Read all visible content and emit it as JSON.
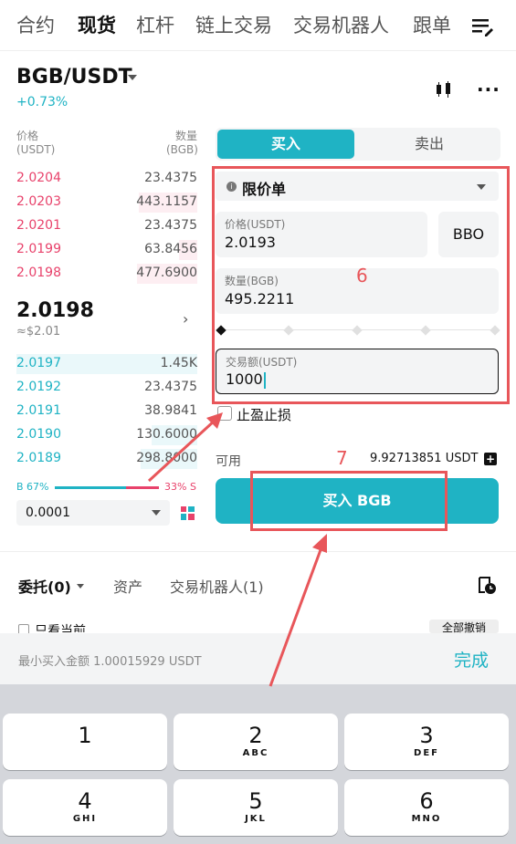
{
  "nav": {
    "tabs": [
      "合约",
      "现货",
      "杠杆",
      "链上交易",
      "交易机器人",
      "跟单"
    ],
    "active": "现货"
  },
  "pair": {
    "symbol": "BGB/USDT",
    "change": "+0.73%"
  },
  "orderbook": {
    "price_header_1": "价格",
    "price_header_2": "(USDT)",
    "qty_header_1": "数量",
    "qty_header_2": "(BGB)",
    "asks": [
      {
        "price": "2.0204",
        "qty": "23.4375"
      },
      {
        "price": "2.0203",
        "qty": "443.1157"
      },
      {
        "price": "2.0201",
        "qty": "23.4375"
      },
      {
        "price": "2.0199",
        "qty": "63.8456"
      },
      {
        "price": "2.0198",
        "qty": "477.6900"
      }
    ],
    "last_price": "2.0198",
    "last_usd": "≈$2.01",
    "bids": [
      {
        "price": "2.0197",
        "qty": "1.45K"
      },
      {
        "price": "2.0192",
        "qty": "23.4375"
      },
      {
        "price": "2.0191",
        "qty": "38.9841"
      },
      {
        "price": "2.0190",
        "qty": "130.6000"
      },
      {
        "price": "2.0189",
        "qty": "298.8000"
      }
    ],
    "buy_ratio": "B 67%",
    "sell_ratio": "33% S",
    "precision": "0.0001"
  },
  "form": {
    "buy_tab": "买入",
    "sell_tab": "卖出",
    "order_type": "限价单",
    "price_label": "价格(USDT)",
    "price_value": "2.0193",
    "bbo": "BBO",
    "qty_label": "数量(BGB)",
    "qty_value": "495.2211",
    "amount_label": "交易额(USDT)",
    "amount_value": "1000",
    "tpsl": "止盈止损",
    "available_label": "可用",
    "available_value": "9.92713851 USDT",
    "buy_button": "买入 BGB"
  },
  "annotations": {
    "step6": "6",
    "step7": "7",
    "color": "#e8565a"
  },
  "bottom": {
    "tabs": [
      "委托(0)",
      "资产",
      "交易机器人(1)"
    ],
    "only_current": "只看当前",
    "cancel_all": "全部撤销"
  },
  "keyboard": {
    "hint": "最小买入金额 1.00015929 USDT",
    "done": "完成",
    "keys": [
      {
        "digit": "1",
        "letters": ""
      },
      {
        "digit": "2",
        "letters": "ABC"
      },
      {
        "digit": "3",
        "letters": "DEF"
      },
      {
        "digit": "4",
        "letters": "GHI"
      },
      {
        "digit": "5",
        "letters": "JKL"
      },
      {
        "digit": "6",
        "letters": "MNO"
      }
    ]
  },
  "colors": {
    "accent": "#1fb3c4",
    "sell": "#e8426b"
  }
}
